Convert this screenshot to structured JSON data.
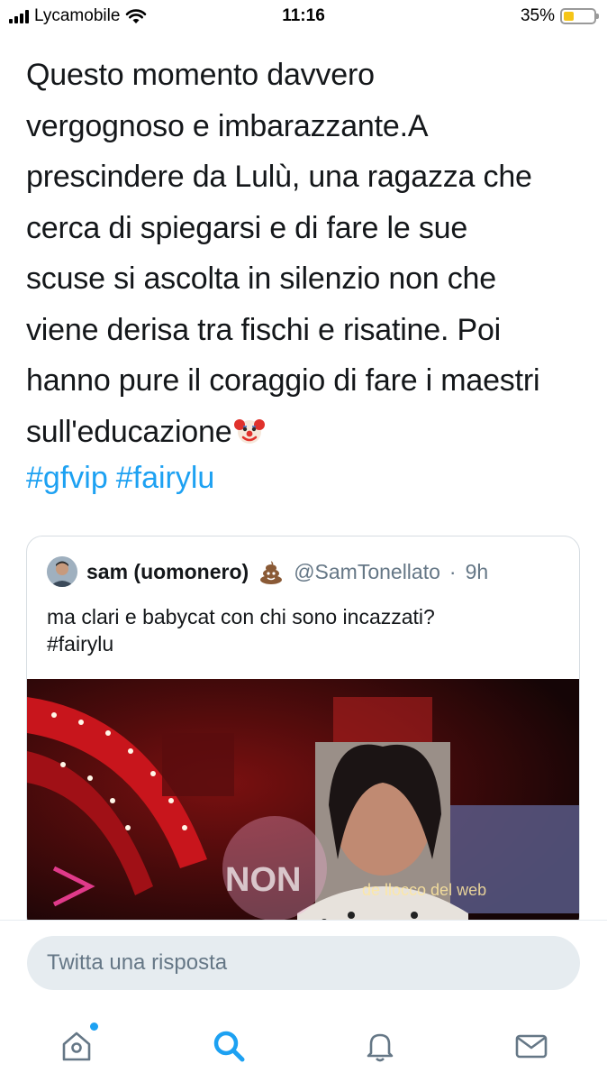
{
  "status_bar": {
    "carrier": "Lycamobile",
    "time": "11:16",
    "battery_percent": "35%",
    "battery_level": 0.35
  },
  "tweet": {
    "lines": [
      "Questo momento davvero",
      "vergognoso e imbarazzante.A",
      "prescindere da Lulù, una ragazza che",
      "cerca di spiegarsi e di fare le sue",
      "scuse si ascolta in silenzio non che",
      "viene derisa tra fischi e risatine. Poi",
      "hanno pure il coraggio di fare i maestri",
      "sull'educazione"
    ],
    "emoji_icon": "clown-face-icon",
    "hashtags": [
      "#gfvip",
      "#fairylu"
    ]
  },
  "quoted_tweet": {
    "name": "sam (uomonero)",
    "emoji_icon": "poop-emoji-icon",
    "handle": "@SamTonellato",
    "separator": "·",
    "time": "9h",
    "text_line1": "ma clari e babycat con chi sono incazzati?",
    "text_line2": "#fairylu",
    "media_icon": "video-thumbnail",
    "watermark_text": "NON",
    "watermark_text2": "de llocco del web"
  },
  "reply": {
    "placeholder": "Twitta una risposta"
  },
  "tab_bar": {
    "items": [
      "home-icon",
      "search-icon",
      "notifications-icon",
      "messages-icon"
    ],
    "active": "search-icon"
  },
  "colors": {
    "accent": "#1da1f2",
    "text": "#14171a",
    "secondary": "#657786"
  }
}
